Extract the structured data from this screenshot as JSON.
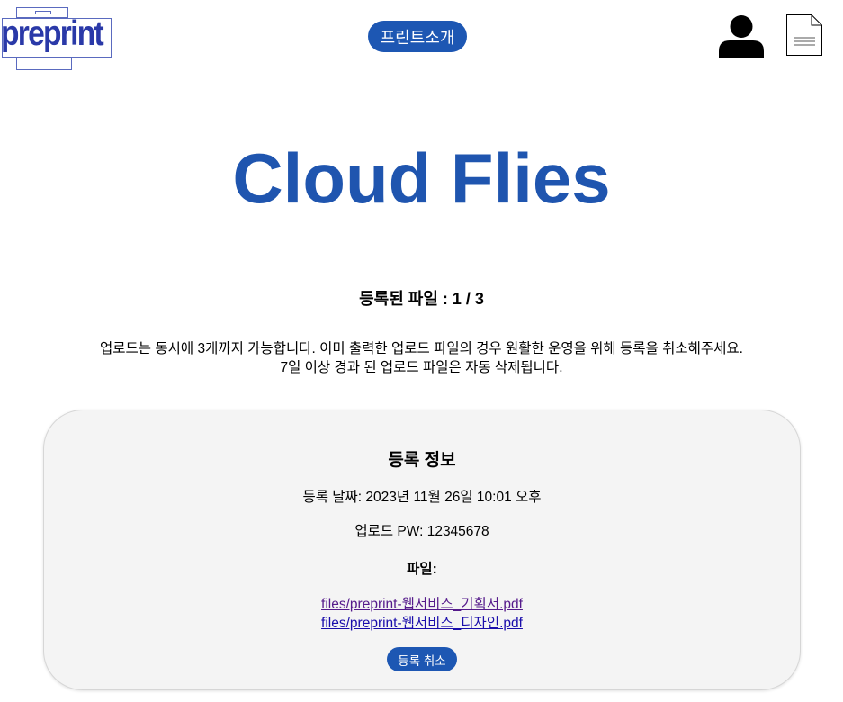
{
  "header": {
    "logo_text": "preprint",
    "nav_label": "프린트소개",
    "icons": [
      "user-icon",
      "document-icon"
    ]
  },
  "main": {
    "title": "Cloud Flies",
    "count_label": "등록된 파일 : 1 / 3",
    "notice_line1": "업로드는 동시에 3개까지 가능합니다. 이미 출력한 업로드 파일의 경우 원활한 운영을 위해 등록을 취소해주세요.",
    "notice_line2": "7일 이상 경과 된 업로드 파일은 자동 삭제됩니다."
  },
  "card": {
    "title": "등록 정보",
    "date_line": "등록 날짜: 2023년 11월 26일 10:01 오후",
    "pw_line": "업로드 PW: 12345678",
    "files_label": "파일:",
    "files": [
      "files/preprint-웹서비스_기획서.pdf",
      "files/preprint-웹서비스_디자인.pdf"
    ],
    "cancel_label": "등록 취소"
  },
  "colors": {
    "accent": "#1d57b3",
    "title": "#1f55af",
    "logo": "#2a39a8",
    "card_bg": "#f4f4f4"
  }
}
